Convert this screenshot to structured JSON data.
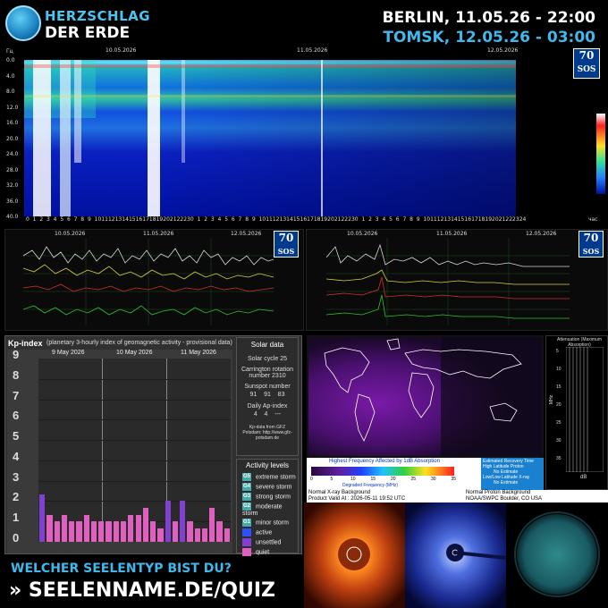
{
  "header": {
    "logo_line1": "HERZSCHLAG",
    "logo_line2": "DER ERDE",
    "city1": "BERLIN, 11.05.26 - 22:00",
    "city2": "TOMSK, 12.05.26 - 03:00"
  },
  "spectrogram": {
    "unit": "Гц",
    "dates": [
      "10.05.2026",
      "11.05.2026",
      "12.05.2026"
    ],
    "y_ticks": [
      "0.0",
      "4.0",
      "8.0",
      "12.0",
      "16.0",
      "20.0",
      "24.0",
      "28.0",
      "32.0",
      "36.0",
      "40.0"
    ],
    "x_ticks": [
      "0",
      "1",
      "2",
      "3",
      "4",
      "5",
      "6",
      "7",
      "8",
      "9",
      "10",
      "11",
      "12",
      "13",
      "14",
      "15",
      "16",
      "17",
      "18",
      "19",
      "20",
      "21",
      "22",
      "23",
      "0",
      "1",
      "2",
      "3",
      "4",
      "5",
      "6",
      "7",
      "8",
      "9",
      "10",
      "11",
      "12",
      "13",
      "14",
      "15",
      "16",
      "17",
      "18",
      "19",
      "20",
      "21",
      "22",
      "23",
      "0",
      "1",
      "2",
      "3",
      "4",
      "5",
      "6",
      "7",
      "8",
      "9",
      "10",
      "11",
      "12",
      "13",
      "14",
      "15",
      "16",
      "17",
      "18",
      "19",
      "20",
      "21",
      "22",
      "23",
      "24"
    ],
    "x_unit": "час",
    "badge_top": "70",
    "badge_letters": "SOS"
  },
  "amplitude": {
    "left_dates": [
      "10.05.2026",
      "11.05.2026",
      "12.05.2026"
    ],
    "right_dates": [
      "10.05.2026",
      "11.05.2026",
      "12.05.2026"
    ]
  },
  "kp": {
    "title": "Kp-index",
    "subtitle": "(planetary 3-hourly index of geomagnetic activity - provisional data)",
    "days": [
      "9 May 2026",
      "10 May 2026",
      "11 May 2026"
    ],
    "y_levels": [
      "0",
      "1",
      "2",
      "3",
      "4",
      "5",
      "6",
      "7",
      "8",
      "9"
    ],
    "values": [
      2.33,
      1.33,
      1.0,
      1.33,
      1.0,
      1.0,
      1.33,
      1.0,
      1.0,
      1.0,
      1.0,
      1.0,
      1.33,
      1.33,
      1.67,
      1.0,
      0.67,
      2.0,
      1.0,
      2.0,
      1.0,
      0.67,
      0.67,
      1.67,
      1.0,
      0.67
    ],
    "colors": {
      "quiet": "#e060c0",
      "unsettled": "#8040d0",
      "active": "#3050ff"
    }
  },
  "solar": {
    "title": "Solar data",
    "cycle": "Solar cycle 25",
    "rotation": "Carrington rotation number 2310",
    "sunspot_label": "Sunspot number",
    "sunspot_values": [
      "91",
      "91",
      "83"
    ],
    "ap_label": "Daily Ap-index",
    "ap_values": [
      "4",
      "4",
      "---"
    ],
    "source": "Kp-data from GFZ Potsdam: http://www.gfz-potsdam.de"
  },
  "activity": {
    "title": "Activity levels",
    "levels": [
      {
        "code": "G5",
        "label": "extreme storm",
        "color": "#4aa"
      },
      {
        "code": "G4",
        "label": "severe storm",
        "color": "#4aa"
      },
      {
        "code": "G3",
        "label": "strong storm",
        "color": "#4aa"
      },
      {
        "code": "G2",
        "label": "moderate storm",
        "color": "#4aa"
      },
      {
        "code": "G1",
        "label": "minor storm",
        "color": "#4aa"
      },
      {
        "code": "",
        "label": "active",
        "color": "#3050ff"
      },
      {
        "code": "",
        "label": "unsettled",
        "color": "#8040d0"
      },
      {
        "code": "",
        "label": "quiet",
        "color": "#e060c0"
      }
    ]
  },
  "drap": {
    "title": "Highest Frequency Affected by 1dB Absorption",
    "scale_label": "Degraded Frequency (MHz)",
    "scale_ticks": [
      "0",
      "5",
      "10",
      "15",
      "20",
      "25",
      "30",
      "35"
    ],
    "recovery_lines": [
      "Estimated Recovery Time",
      "High Latitude Proton",
      "No Estimate",
      "Low/Low Latitude X-ray",
      "No Estimate"
    ],
    "atten_title": "Attenuation (Maximum Absorption)",
    "atten_unit": "dB",
    "atten_axis": "MHz",
    "atten_ticks": [
      "5",
      "10",
      "15",
      "20",
      "25",
      "30",
      "35"
    ],
    "xray": "Normal X-ray Background",
    "product": "Product Valid At : 2026-05-11  19:52 UTC",
    "proton": "Normal Proton Background",
    "noaa": "NOAA/SWPC Boulder, CO USA"
  },
  "ad": {
    "line1": "WELCHER SEELENTYP BIST DU?",
    "line2": "» SEELENNAME.DE/QUIZ"
  }
}
